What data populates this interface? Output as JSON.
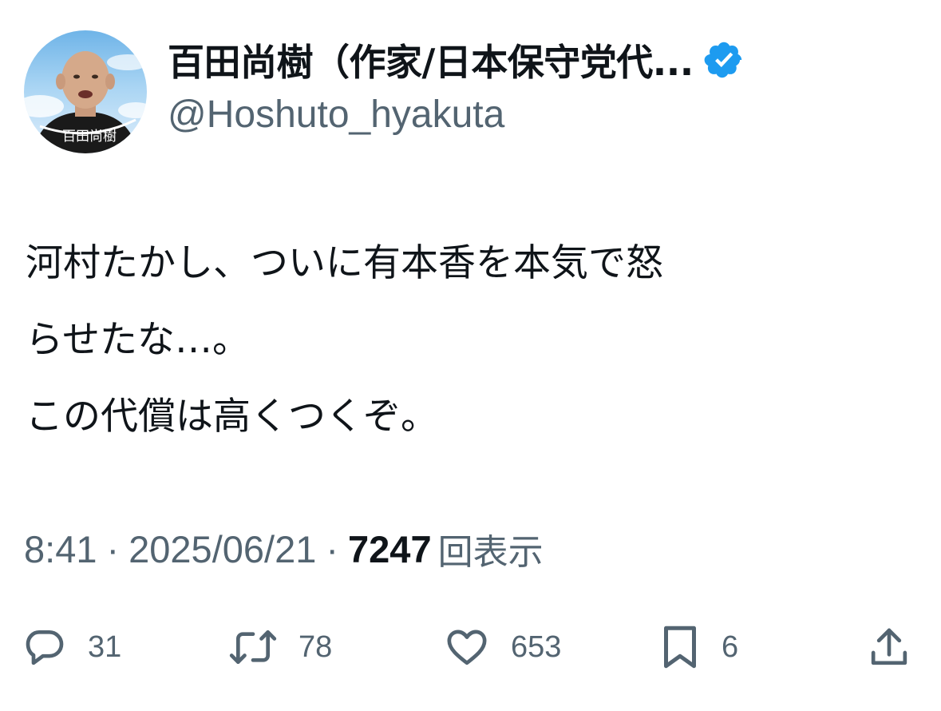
{
  "user": {
    "display_name": "百田尚樹（作家/日本保守党代...",
    "handle": "@Hoshuto_hyakuta",
    "avatar_icon": "avatar-photo",
    "verified_icon": "verified-badge-icon",
    "avatar_caption": "百田尚樹"
  },
  "tweet": {
    "lines": [
      "河村たかし、ついに有本香を本気で怒",
      "らせたな…。",
      "この代償は高くつくぞ。"
    ],
    "time": "8:41",
    "separator": "·",
    "date": "2025/06/21",
    "views": "7247",
    "views_label": "回表示"
  },
  "actions": {
    "reply": {
      "icon": "reply-icon",
      "count": "31"
    },
    "retweet": {
      "icon": "retweet-icon",
      "count": "78"
    },
    "like": {
      "icon": "heart-icon",
      "count": "653"
    },
    "bookmark": {
      "icon": "bookmark-icon",
      "count": "6"
    },
    "share": {
      "icon": "share-icon"
    }
  },
  "colors": {
    "text_primary": "#0f1419",
    "text_secondary": "#536471",
    "verified_blue": "#1d9bf0",
    "background": "#ffffff"
  }
}
